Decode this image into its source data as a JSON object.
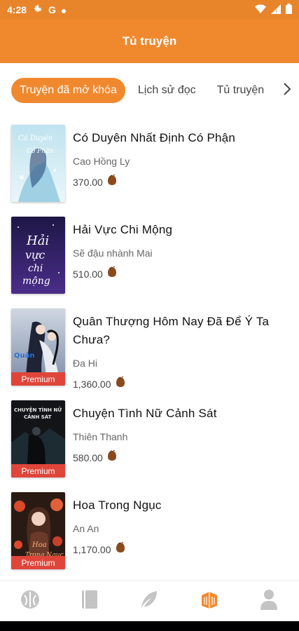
{
  "status_bar": {
    "time": "4:28",
    "icons": [
      "settings-icon",
      "google-icon",
      "dot-icon",
      "wifi-icon",
      "signal-icon",
      "battery-icon"
    ]
  },
  "app_bar": {
    "title": "Tủ truyện"
  },
  "tabs": [
    {
      "label": "Truyện đã mở khóa",
      "active": true
    },
    {
      "label": "Lịch sử đọc",
      "active": false
    },
    {
      "label": "Tủ truyện",
      "active": false
    }
  ],
  "books": [
    {
      "title": "Có Duyên Nhất Định Có Phận",
      "author": "Cao Hồng Ly",
      "price": "370.00",
      "premium": false
    },
    {
      "title": "Hải Vực Chi Mộng",
      "author": "Sẽ đậu nhành Mai",
      "price": "510.00",
      "premium": false
    },
    {
      "title": "Quân Thượng Hôm Nay Đã Để Ý Ta Chưa?",
      "author": "Đa Hi",
      "price": "1,360.00",
      "premium": true,
      "premium_label": "Premium"
    },
    {
      "title": "Chuyện Tình Nữ Cảnh Sát",
      "author": "Thiên Thanh",
      "price": "580.00",
      "premium": true,
      "premium_label": "Premium"
    },
    {
      "title": "Hoa Trong Ngục",
      "author": "An An",
      "price": "1,170.00",
      "premium": true,
      "premium_label": "Premium"
    }
  ],
  "bottom_nav": [
    {
      "icon": "explore-icon",
      "active": false
    },
    {
      "icon": "book-icon",
      "active": false
    },
    {
      "icon": "feather-icon",
      "active": false
    },
    {
      "icon": "bookshelf-icon",
      "active": true
    },
    {
      "icon": "profile-icon",
      "active": false
    }
  ],
  "colors": {
    "accent": "#f0892e",
    "status_bar": "#e8842a",
    "premium_badge": "#e0453a",
    "coin": "#8b4a1e",
    "nav_inactive": "#c4c4c4"
  }
}
